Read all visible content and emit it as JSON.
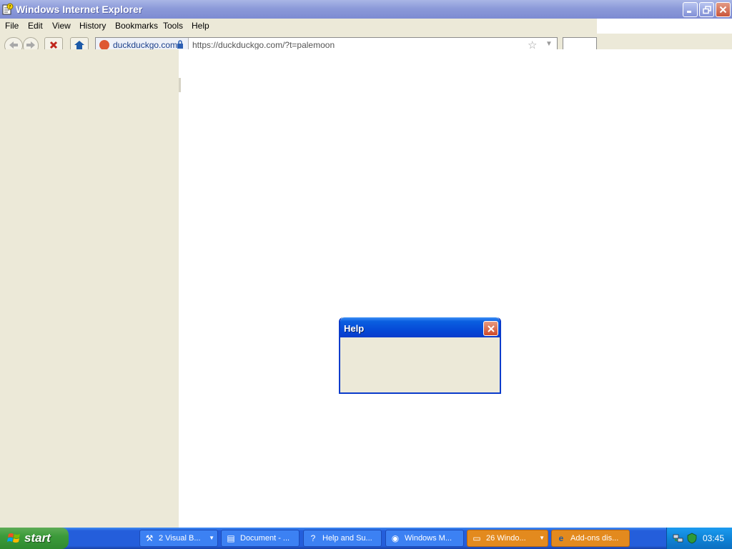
{
  "window": {
    "title": "Windows Internet Explorer"
  },
  "menu": {
    "items": [
      {
        "label": "File"
      },
      {
        "label": "Edit"
      },
      {
        "label": "View"
      },
      {
        "label": "History"
      },
      {
        "label": "Bookmarks"
      },
      {
        "label": "Tools"
      },
      {
        "label": "Help"
      }
    ]
  },
  "addressbar": {
    "site_identity": "duckduckgo.com",
    "url": "https://duckduckgo.com/?t=palemoon"
  },
  "dialog": {
    "title": "Help"
  },
  "taskbar": {
    "start_label": "start",
    "buttons": [
      {
        "label": "2 Visual B...",
        "icon": "visual-basic-icon"
      },
      {
        "label": "Document - ...",
        "icon": "notepad-icon"
      },
      {
        "label": "Help and Su...",
        "icon": "help-icon"
      },
      {
        "label": "Windows M...",
        "icon": "media-player-icon"
      },
      {
        "label": "26 Windo...",
        "icon": "folder-icon"
      },
      {
        "label": "Add-ons dis...",
        "icon": "ie-icon"
      }
    ],
    "clock": "03:45"
  },
  "colors": {
    "taskbar_blue": "#245edb",
    "start_green": "#3c9b3a",
    "dialog_title_blue": "#0a3bcb",
    "task_active_orange": "#e38a1e",
    "chrome_beige": "#ece9d8"
  }
}
